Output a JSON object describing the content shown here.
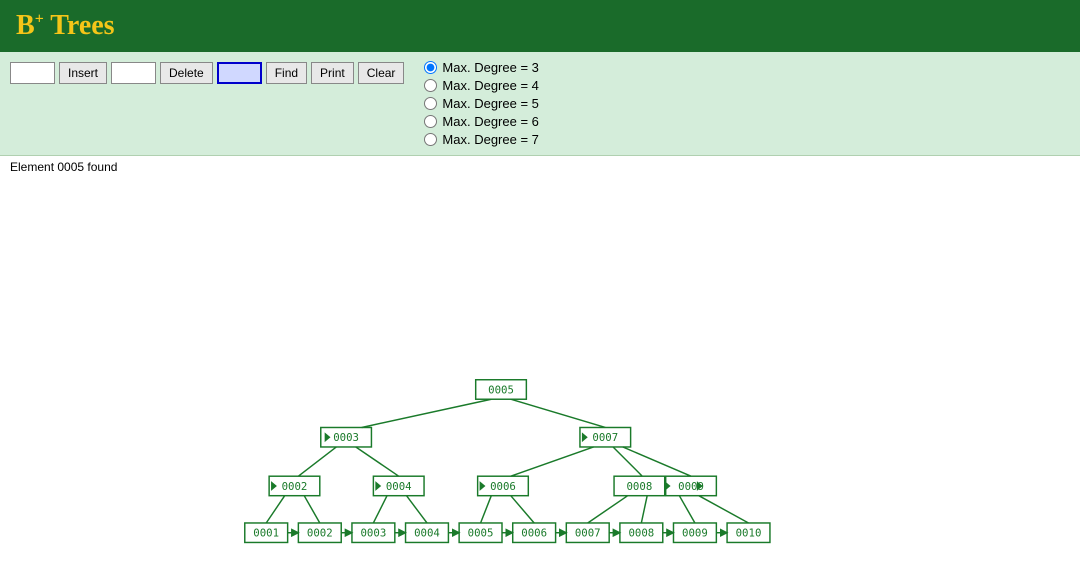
{
  "header": {
    "title": "B",
    "sup": "+",
    "subtitle": " Trees"
  },
  "toolbar": {
    "insert_input_placeholder": "",
    "insert_btn": "Insert",
    "delete_input_placeholder": "",
    "delete_btn": "Delete",
    "find_input_value": "",
    "find_btn": "Find",
    "print_btn": "Print",
    "clear_btn": "Clear"
  },
  "degrees": [
    {
      "label": "Max. Degree = 3",
      "value": "3",
      "checked": true
    },
    {
      "label": "Max. Degree = 4",
      "value": "4",
      "checked": false
    },
    {
      "label": "Max. Degree = 5",
      "value": "5",
      "checked": false
    },
    {
      "label": "Max. Degree = 6",
      "value": "6",
      "checked": false
    },
    {
      "label": "Max. Degree = 7",
      "value": "7",
      "checked": false
    }
  ],
  "status": "Element 0005 found",
  "tree": {
    "nodes": {
      "root": "0005",
      "level2_left": "0003",
      "level2_right": "0007",
      "level3_1": "0002",
      "level3_2": "0004",
      "level3_3": "0006",
      "level3_4": "0008",
      "level3_5": "0009"
    },
    "leaves": [
      "0001",
      "0002",
      "0003",
      "0004",
      "0005",
      "0006",
      "0007",
      "0008",
      "0009",
      "0010"
    ]
  },
  "colors": {
    "tree_green": "#1a7a2a",
    "header_bg": "#1a6b2a",
    "toolbar_bg": "#d4edda"
  }
}
